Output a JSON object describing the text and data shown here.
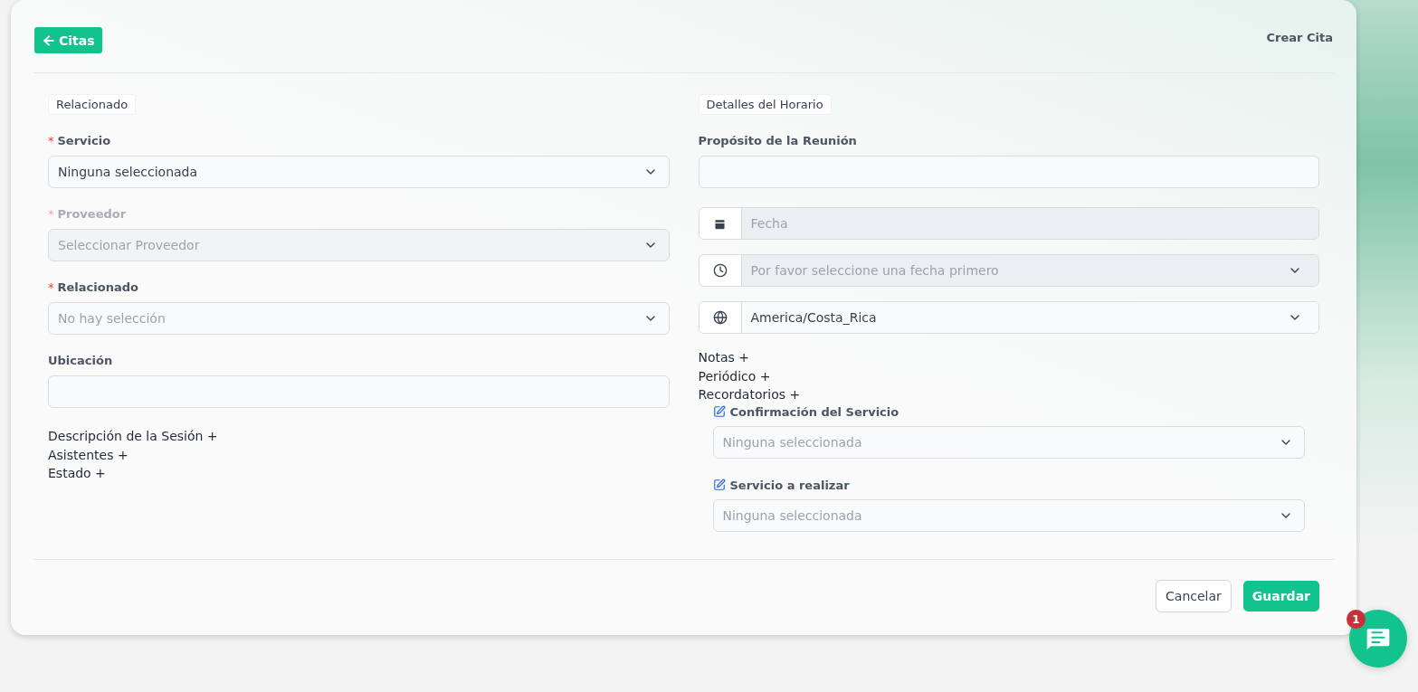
{
  "header": {
    "back_button": "Citas",
    "title": "Crear Cita"
  },
  "left": {
    "section": "Relacionado",
    "fields": [
      {
        "kind": "select",
        "label": "Servicio",
        "required_mark": "*",
        "disabled": false,
        "value": "Ninguna seleccionada"
      },
      {
        "kind": "select",
        "label": "Proveedor",
        "required_mark": "*",
        "disabled": true,
        "placeholder": "Seleccionar Proveedor"
      },
      {
        "kind": "select",
        "label": "Relacionado",
        "required_mark": "*",
        "disabled": false,
        "placeholder": "No hay selección"
      },
      {
        "kind": "text",
        "label": "Ubicación",
        "disabled": false
      }
    ],
    "toggles": [
      "Descripción de la Sesión +",
      "Asistentes +",
      "Estado +"
    ]
  },
  "right": {
    "section": "Detalles del Horario",
    "fields": [
      {
        "kind": "text",
        "label": "Propósito de la Reunión",
        "disabled": false
      },
      {
        "kind": "date",
        "placeholder": "Fecha"
      },
      {
        "kind": "time",
        "disabled": true,
        "placeholder": "Por favor seleccione una fecha primero"
      },
      {
        "kind": "timezone",
        "value": "America/Costa_Rica"
      }
    ],
    "toggles": [
      "Notas +",
      "Periódico +",
      "Recordatorios +"
    ],
    "reminders": [
      {
        "label": "Confirmación del Servicio",
        "placeholder": "Ninguna seleccionada"
      },
      {
        "label": "Servicio a realizar",
        "placeholder": "Ninguna seleccionada"
      }
    ]
  },
  "footer": {
    "cancel": "Cancelar",
    "save": "Guardar"
  },
  "chat": {
    "badge": "1"
  }
}
